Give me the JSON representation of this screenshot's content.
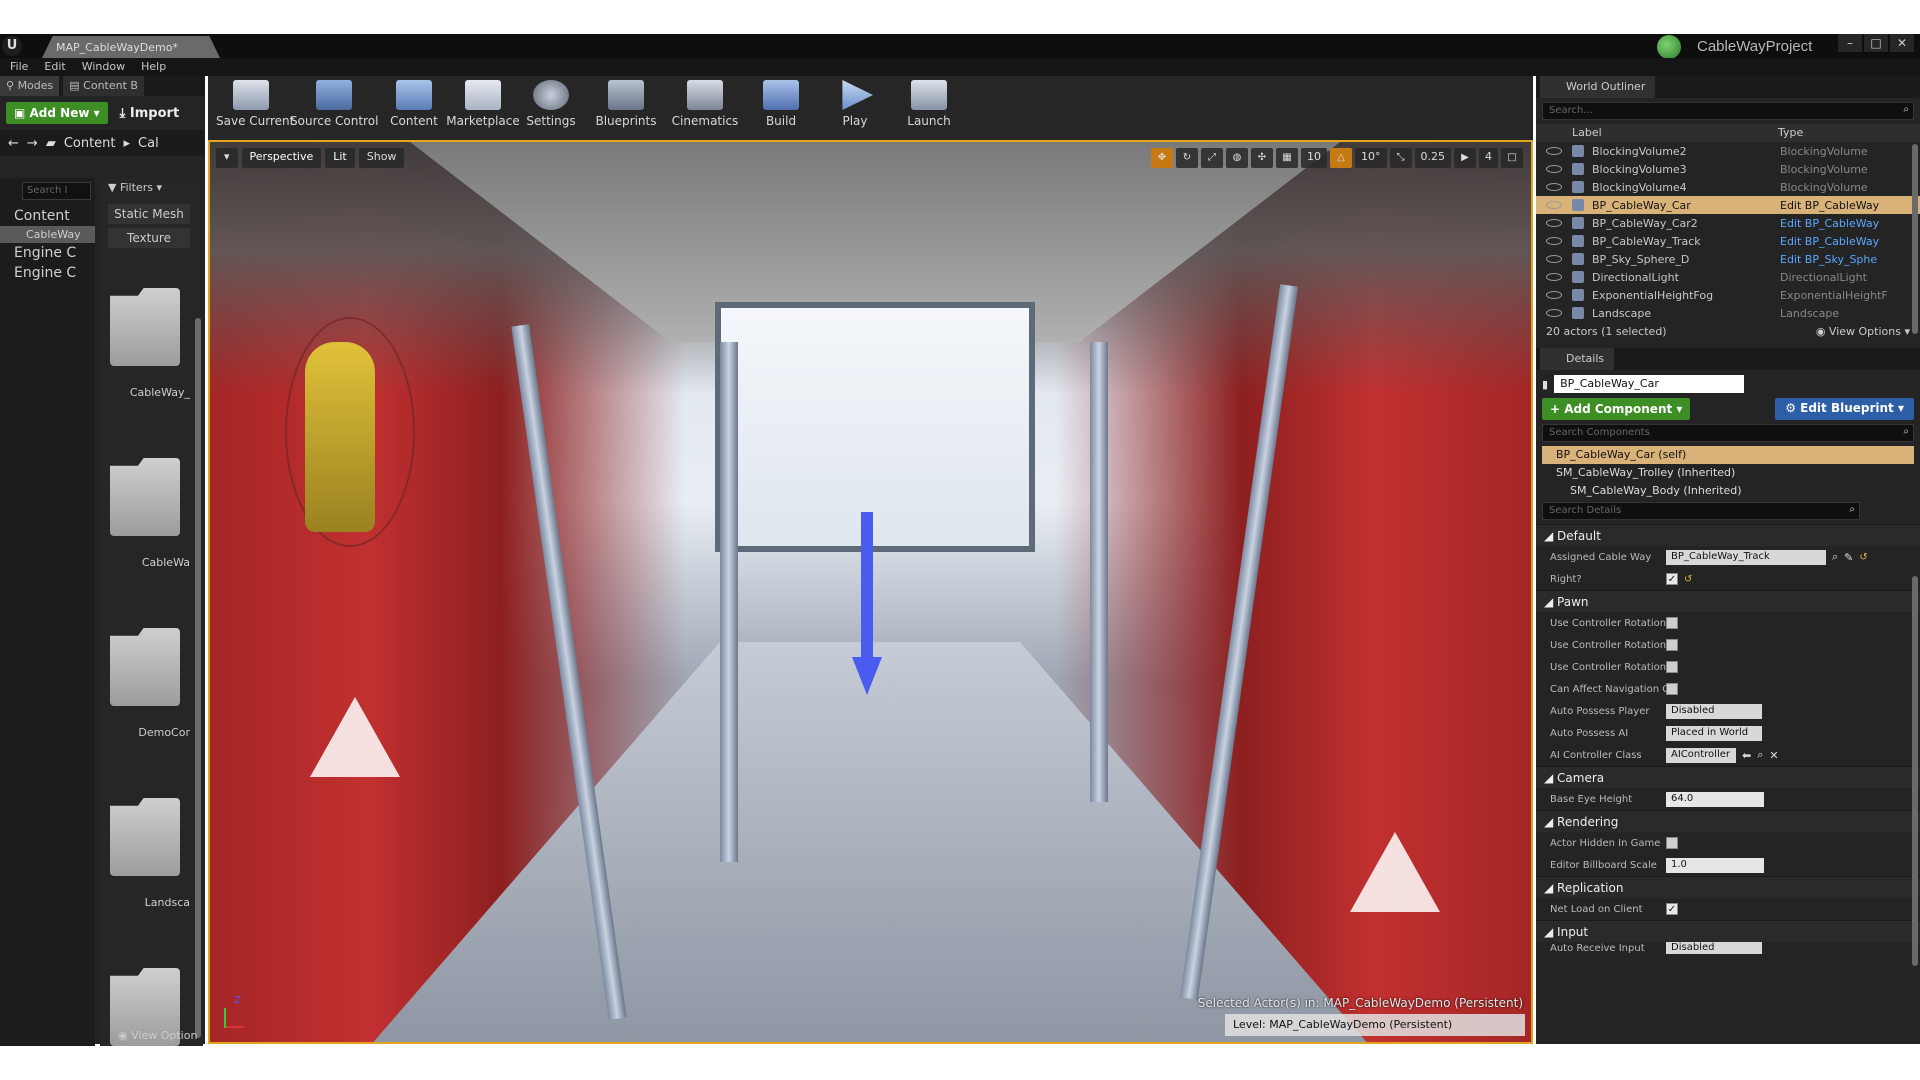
{
  "window": {
    "doc_tab": "MAP_CableWayDemo*",
    "project_name": "CableWayProject",
    "min_label": "–",
    "max_label": "□",
    "close_label": "✕"
  },
  "menu": [
    "File",
    "Edit",
    "Window",
    "Help"
  ],
  "left_panel": {
    "tab_modes": "Modes",
    "tab_content": "Content B",
    "add_new": "Add New",
    "import": "Import",
    "path_root": "Content",
    "path_child": "Cal",
    "search_placeholder": "Search I",
    "tree": [
      "Content",
      "CableWay",
      "Engine C",
      "Engine C"
    ],
    "filters": "Filters",
    "filter_chips": [
      "Static Mesh",
      "Texture"
    ],
    "assets": [
      "CableWay_",
      "CableWa",
      "DemoCor",
      "Landsca",
      ""
    ],
    "view_options": "View Option"
  },
  "toolbar": [
    {
      "label": "Save Current",
      "icon": "save-icon"
    },
    {
      "label": "Source Control",
      "icon": "source-control-icon"
    },
    {
      "label": "Content",
      "icon": "content-icon"
    },
    {
      "label": "Marketplace",
      "icon": "marketplace-icon"
    },
    {
      "label": "Settings",
      "icon": "settings-icon"
    },
    {
      "label": "Blueprints",
      "icon": "blueprints-icon"
    },
    {
      "label": "Cinematics",
      "icon": "cinematics-icon"
    },
    {
      "label": "Build",
      "icon": "build-icon"
    },
    {
      "label": "Play",
      "icon": "play-icon"
    },
    {
      "label": "Launch",
      "icon": "launch-icon"
    }
  ],
  "viewport": {
    "perspective": "Perspective",
    "lit": "Lit",
    "show": "Show",
    "grid_snap": "10",
    "rot_snap": "10°",
    "scale_snap": "0.25",
    "camera_speed": "4",
    "selected_actor": "Selected Actor(s) in:  MAP_CableWayDemo (Persistent)",
    "level": "Level:  MAP_CableWayDemo (Persistent)",
    "axis_z": "Z"
  },
  "outliner": {
    "tab": "World Outliner",
    "search_placeholder": "Search...",
    "col_label": "Label",
    "col_type": "Type",
    "rows": [
      {
        "label": "BlockingVolume2",
        "type": "BlockingVolume",
        "link": false,
        "selected": false
      },
      {
        "label": "BlockingVolume3",
        "type": "BlockingVolume",
        "link": false,
        "selected": false
      },
      {
        "label": "BlockingVolume4",
        "type": "BlockingVolume",
        "link": false,
        "selected": false
      },
      {
        "label": "BP_CableWay_Car",
        "type": "Edit BP_CableWay",
        "link": true,
        "selected": true
      },
      {
        "label": "BP_CableWay_Car2",
        "type": "Edit BP_CableWay",
        "link": true,
        "selected": false
      },
      {
        "label": "BP_CableWay_Track",
        "type": "Edit BP_CableWay",
        "link": true,
        "selected": false
      },
      {
        "label": "BP_Sky_Sphere_D",
        "type": "Edit BP_Sky_Sphe",
        "link": true,
        "selected": false
      },
      {
        "label": "DirectionalLight",
        "type": "DirectionalLight",
        "link": false,
        "selected": false
      },
      {
        "label": "ExponentialHeightFog",
        "type": "ExponentialHeightF",
        "link": false,
        "selected": false
      },
      {
        "label": "Landscape",
        "type": "Landscape",
        "link": false,
        "selected": false
      }
    ],
    "count": "20 actors (1 selected)",
    "view_options": "View Options"
  },
  "details": {
    "tab": "Details",
    "name": "BP_CableWay_Car",
    "add_component": "Add Component",
    "edit_blueprint": "Edit Blueprint",
    "search_components": "Search Components",
    "components": [
      "BP_CableWay_Car (self)",
      "SM_CableWay_Trolley (Inherited)",
      "SM_CableWay_Body (Inherited)"
    ],
    "search_details": "Search Details",
    "categories": {
      "default": "Default",
      "pawn": "Pawn",
      "camera": "Camera",
      "rendering": "Rendering",
      "replication": "Replication",
      "input": "Input"
    },
    "props": {
      "assigned_cable_way": {
        "label": "Assigned Cable Way",
        "value": "BP_CableWay_Track"
      },
      "right": {
        "label": "Right?",
        "checked": true
      },
      "ucr1": {
        "label": "Use Controller Rotation",
        "checked": false
      },
      "ucr2": {
        "label": "Use Controller Rotation",
        "checked": false
      },
      "ucr3": {
        "label": "Use Controller Rotation",
        "checked": false
      },
      "can_affect_nav": {
        "label": "Can Affect Navigation G",
        "checked": false
      },
      "auto_possess_player": {
        "label": "Auto Possess Player",
        "value": "Disabled"
      },
      "auto_possess_ai": {
        "label": "Auto Possess AI",
        "value": "Placed in World"
      },
      "ai_controller_class": {
        "label": "AI Controller Class",
        "value": "AIController"
      },
      "base_eye_height": {
        "label": "Base Eye Height",
        "value": "64.0"
      },
      "actor_hidden": {
        "label": "Actor Hidden In Game",
        "checked": false
      },
      "billboard_scale": {
        "label": "Editor Billboard Scale",
        "value": "1.0"
      },
      "net_load": {
        "label": "Net Load on Client",
        "checked": true
      },
      "auto_receive_input": {
        "label": "Auto Receive Input",
        "value": "Disabled"
      }
    }
  },
  "colors": {
    "accent_orange": "#e0a41e",
    "selected_row": "#d9b27a",
    "add_green": "#3d8e24",
    "edit_blue": "#2d5fa8",
    "gizmo_blue": "#4a5cf0",
    "link_blue": "#5aa8ff"
  }
}
